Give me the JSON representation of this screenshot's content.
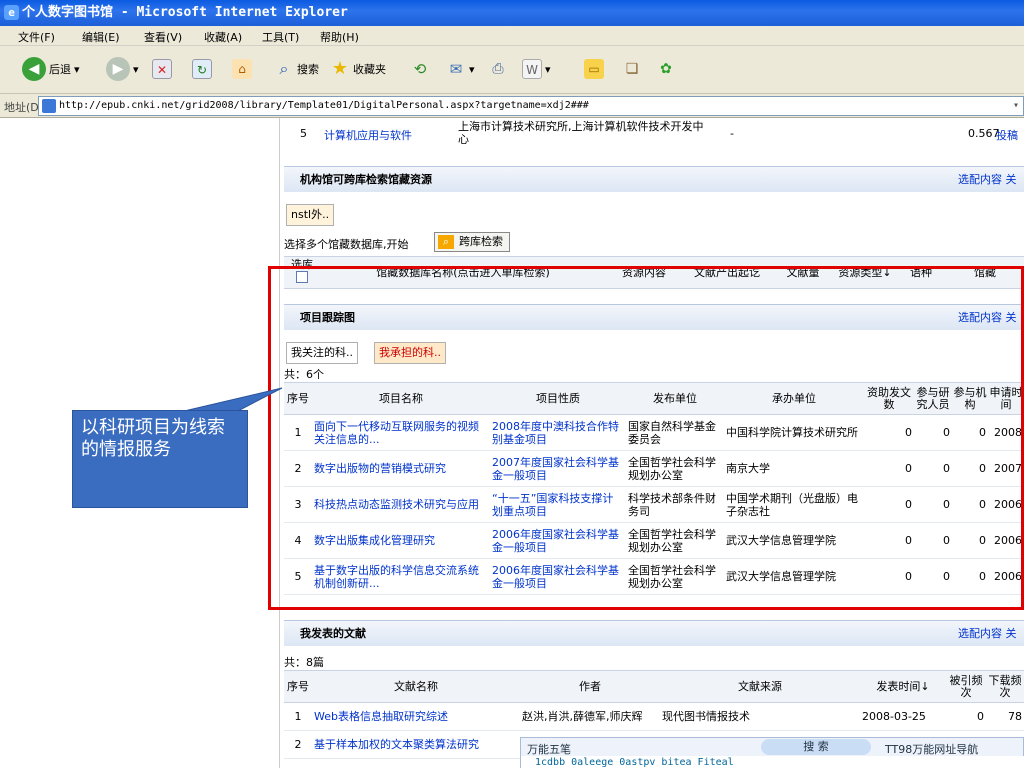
{
  "window": {
    "title": "个人数字图书馆 - Microsoft Internet Explorer"
  },
  "menu": [
    "文件(F)",
    "编辑(E)",
    "查看(V)",
    "收藏(A)",
    "工具(T)",
    "帮助(H)"
  ],
  "toolbar": {
    "back": "后退",
    "search": "搜索",
    "favorites": "收藏夹"
  },
  "address": {
    "label": "地址(D)",
    "url": "http://epub.cnki.net/grid2008/library/Template01/DigitalPersonal.aspx?targetname=xdj2###"
  },
  "top_row": {
    "num": "5",
    "name": "计算机应用与软件",
    "org": "上海市计算技术研究所,上海计算机软件技术开发中心",
    "dash": "-",
    "value": "0.567",
    "link": "投稿"
  },
  "sections": {
    "cross_db": {
      "title": "机构馆可跨库检索馆藏资源",
      "right": "选配内容 关",
      "tab": "nstl外..",
      "hint": "选择多个馆藏数据库,开始",
      "button": "跨库检索",
      "headers": [
        "选库",
        "馆藏数据库名称(点击进入单库检索)",
        "资源内容",
        "文献产出起讫",
        "文献量",
        "资源类型↓",
        "语种",
        "馆藏"
      ]
    },
    "project": {
      "title": "项目跟踪图",
      "right": "选配内容 关",
      "tabs": [
        "我关注的科..",
        "我承担的科.."
      ],
      "total": "共：6个",
      "headers": [
        "序号",
        "项目名称",
        "项目性质",
        "发布单位",
        "承办单位",
        "资助发文数",
        "参与研究人员",
        "参与机构",
        "申请时间"
      ],
      "rows": [
        [
          "1",
          "面向下一代移动互联网服务的视频关注信息的...",
          "2008年度中澳科技合作特别基金项目",
          "国家自然科学基金委员会",
          "中国科学院计算技术研究所",
          "0",
          "0",
          "0",
          "2008"
        ],
        [
          "2",
          "数字出版物的营销模式研究",
          "2007年度国家社会科学基金一般项目",
          "全国哲学社会科学规划办公室",
          "南京大学",
          "0",
          "0",
          "0",
          "2007"
        ],
        [
          "3",
          "科技热点动态监测技术研究与应用",
          "“十一五”国家科技支撑计划重点项目",
          "科学技术部条件财务司",
          "中国学术期刊（光盘版）电子杂志社",
          "0",
          "0",
          "0",
          "2006"
        ],
        [
          "4",
          "数字出版集成化管理研究",
          "2006年度国家社会科学基金一般项目",
          "全国哲学社会科学规划办公室",
          "武汉大学信息管理学院",
          "0",
          "0",
          "0",
          "2006"
        ],
        [
          "5",
          "基于数字出版的科学信息交流系统机制创新研...",
          "2006年度国家社会科学基金一般项目",
          "全国哲学社会科学规划办公室",
          "武汉大学信息管理学院",
          "0",
          "0",
          "0",
          "2006"
        ]
      ]
    },
    "papers": {
      "title": "我发表的文献",
      "right": "选配内容 关",
      "total": "共：8篇",
      "headers": [
        "序号",
        "文献名称",
        "作者",
        "文献来源",
        "发表时间↓",
        "被引频次",
        "下载频次"
      ],
      "rows": [
        [
          "1",
          "Web表格信息抽取研究综述",
          "赵洪,肖洪,薛德军,师庆辉",
          "现代图书情报技术",
          "2008-03-25",
          "0",
          "78"
        ],
        [
          "2",
          "基于样本加权的文本聚类算法研究",
          "",
          "",
          "",
          "",
          ""
        ]
      ]
    }
  },
  "callout": "以科研项目为线索的情报服务",
  "ime": {
    "left": "万能五笔",
    "search": "搜 索",
    "nav": "TT98万能网址导航",
    "bottom": "1cdbb 0aleege 0astpv bitea Fiteal"
  }
}
